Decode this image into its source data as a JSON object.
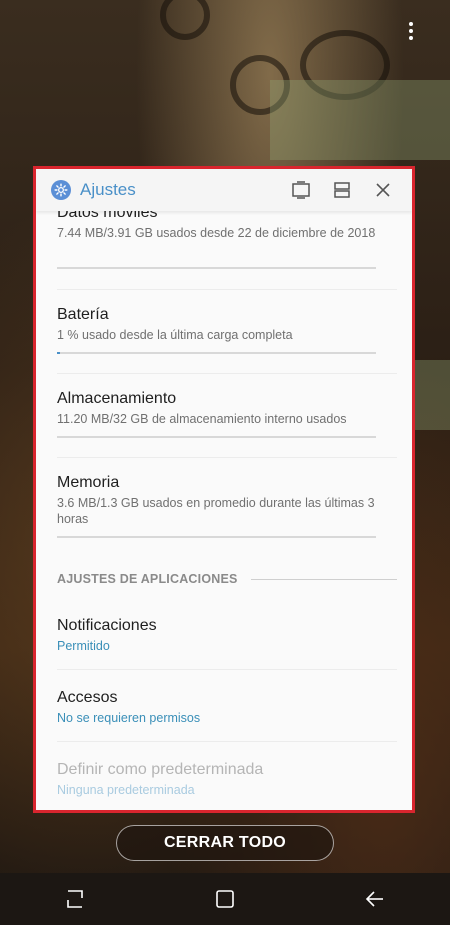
{
  "header": {
    "title": "Ajustes",
    "app_icon": "gear-icon"
  },
  "items": {
    "mobile_data": {
      "title": "Datos móviles",
      "subtitle": "7.44 MB/3.91 GB usados desde 22 de diciembre de 2018"
    },
    "battery": {
      "title": "Batería",
      "subtitle": "1 % usado desde la última carga completa",
      "usage_fraction": 0.01
    },
    "storage": {
      "title": "Almacenamiento",
      "subtitle": "11.20 MB/32 GB de almacenamiento interno usados"
    },
    "memory": {
      "title": "Memoria",
      "subtitle": "3.6 MB/1.3 GB usados en promedio durante las últimas 3 horas"
    }
  },
  "section": {
    "label": "AJUSTES DE APLICACIONES"
  },
  "app_settings": {
    "notifications": {
      "title": "Notificaciones",
      "value": "Permitido"
    },
    "permissions": {
      "title": "Accesos",
      "value": "No se requieren permisos"
    },
    "default": {
      "title": "Definir como predeterminada",
      "value": "Ninguna predeterminada"
    }
  },
  "close_all_label": "CERRAR TODO",
  "colors": {
    "accent": "#4a90c8",
    "highlight_border": "#d9252e"
  }
}
